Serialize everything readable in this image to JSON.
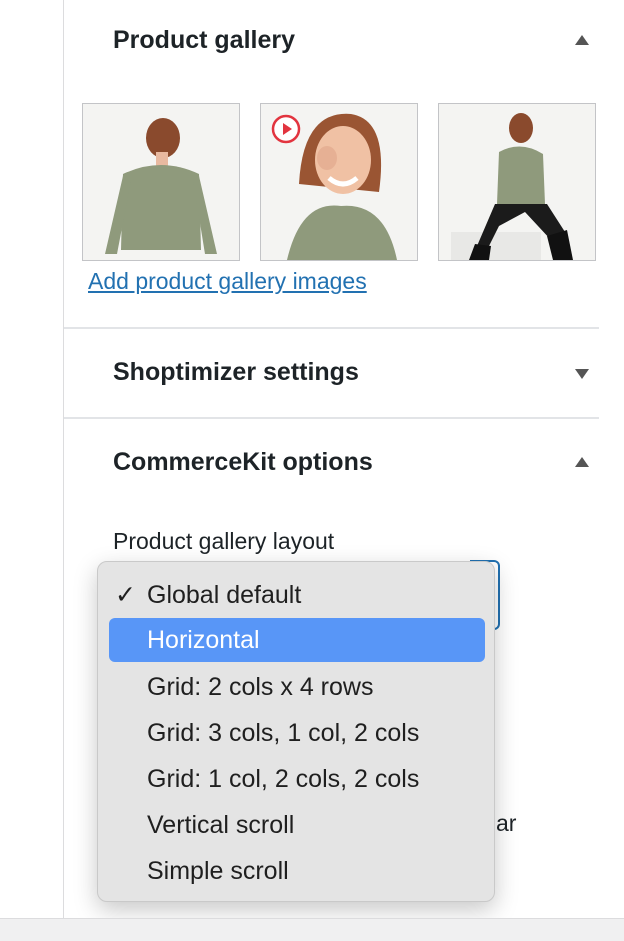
{
  "gallery": {
    "title": "Product gallery",
    "add_link": "Add product gallery images",
    "images": [
      {
        "name": "back-view",
        "has_video": false
      },
      {
        "name": "front-smile",
        "has_video": true
      },
      {
        "name": "seated",
        "has_video": false
      }
    ]
  },
  "shoptimizer": {
    "title": "Shoptimizer settings"
  },
  "commercekit": {
    "title": "CommerceKit options",
    "field_label": "Product gallery layout",
    "obscured_text": "ar"
  },
  "dropdown": {
    "checked_index": 0,
    "highlighted_index": 1,
    "options": [
      "Global default",
      "Horizontal",
      "Grid: 2 cols x 4 rows",
      "Grid: 3 cols, 1 col, 2 cols",
      "Grid: 1 col, 2 cols, 2 cols",
      "Vertical scroll",
      "Simple scroll"
    ],
    "check_mark": "✓"
  },
  "colors": {
    "link": "#2271b1",
    "highlight": "#5896f7",
    "video_badge": "#e2343f"
  }
}
